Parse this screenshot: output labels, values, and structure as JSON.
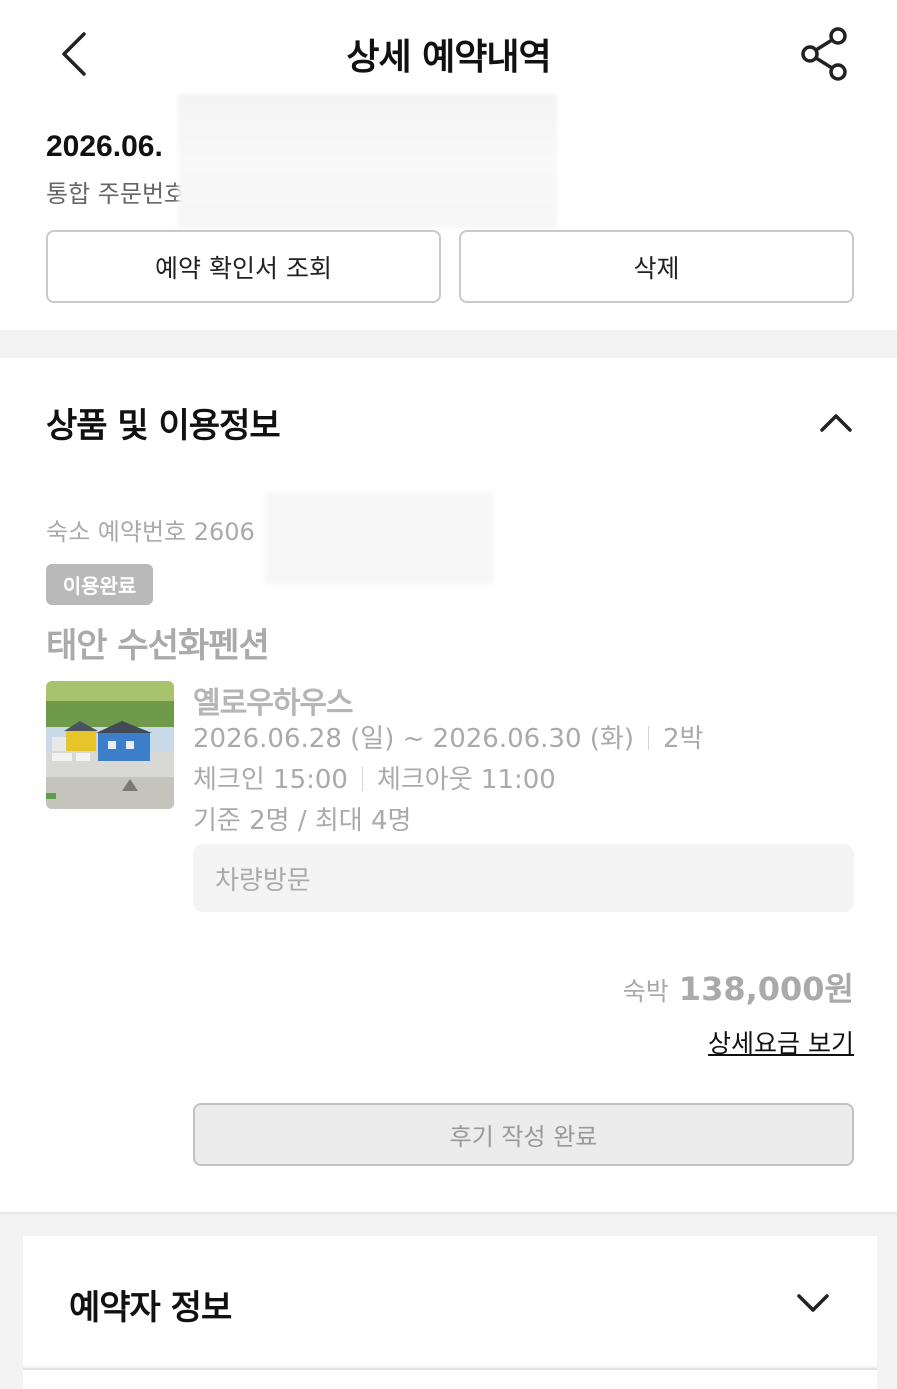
{
  "header": {
    "title": "상세 예약내역",
    "back_icon": "chevron-left-icon",
    "share_icon": "share-icon"
  },
  "order": {
    "date": "2026.06.",
    "number_label": "통합 주문번호"
  },
  "actions": {
    "confirm_label": "예약 확인서 조회",
    "delete_label": "삭제"
  },
  "section": {
    "title": "상품 및 이용정보",
    "collapse_icon": "chevron-up-icon"
  },
  "reservation": {
    "number_label": "숙소 예약번호 2606",
    "status": "이용완료",
    "property_name": "태안 수선화펜션",
    "room_name": "옐로우하우스",
    "dates": "2026.06.28 (일) ~ 2026.06.30 (화)",
    "nights": "2박",
    "checkin": "체크인 15:00",
    "checkout": "체크아웃 11:00",
    "capacity": "기준 2명 / 최대 4명",
    "request": "차량방문"
  },
  "price": {
    "label": "숙박",
    "value": "138,000원",
    "detail_link": "상세요금 보기"
  },
  "review": {
    "label": "후기 작성 완료"
  },
  "booker": {
    "title": "예약자 정보",
    "expand_icon": "chevron-down-icon"
  },
  "colors": {
    "badge": "#b9b9b9",
    "muted_text": "#aaaaaa",
    "band": "#f3f3f3"
  }
}
